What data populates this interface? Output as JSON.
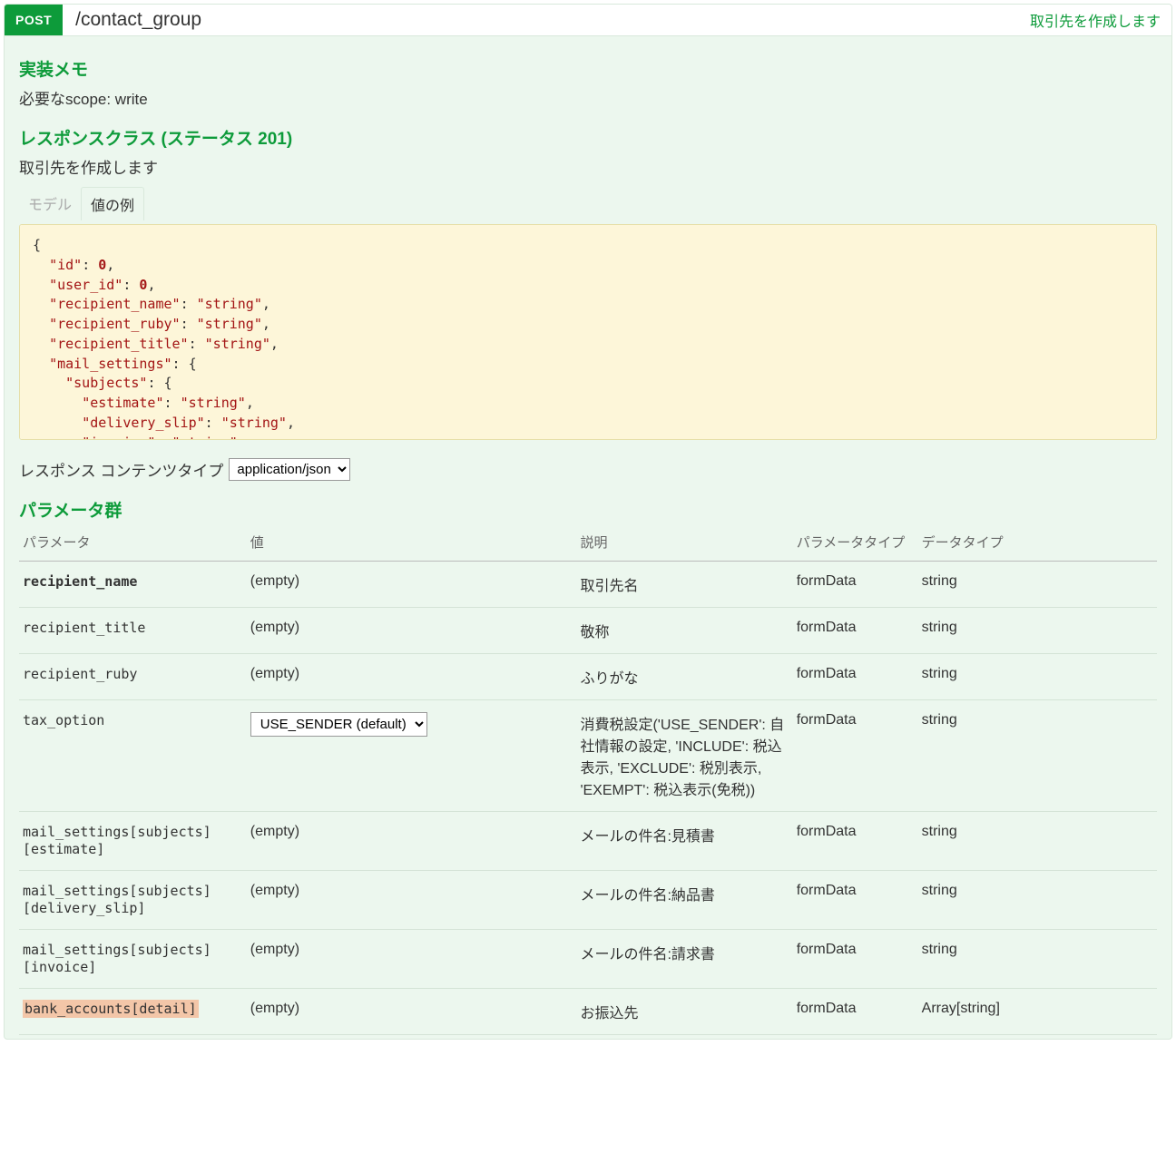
{
  "header": {
    "method": "POST",
    "path": "/contact_group",
    "summary": "取引先を作成します"
  },
  "memo": {
    "title": "実装メモ",
    "body": "必要なscope: write"
  },
  "response": {
    "title": "レスポンスクラス (ステータス 201)",
    "description": "取引先を作成します",
    "tab_model": "モデル",
    "tab_example": "値の例"
  },
  "content_type": {
    "label": "レスポンス コンテンツタイプ",
    "selected": "application/json"
  },
  "params_section": {
    "title": "パラメータ群",
    "headers": {
      "param": "パラメータ",
      "value": "値",
      "desc": "説明",
      "ptype": "パラメータタイプ",
      "dtype": "データタイプ"
    }
  },
  "tax_option_selected": "USE_SENDER (default)",
  "empty_text": "(empty)",
  "params": [
    {
      "name": "recipient_name",
      "required": true,
      "value_type": "empty",
      "desc": "取引先名",
      "ptype": "formData",
      "dtype": "string"
    },
    {
      "name": "recipient_title",
      "value_type": "empty",
      "desc": "敬称",
      "ptype": "formData",
      "dtype": "string"
    },
    {
      "name": "recipient_ruby",
      "value_type": "empty",
      "desc": "ふりがな",
      "ptype": "formData",
      "dtype": "string"
    },
    {
      "name": "tax_option",
      "value_type": "select",
      "desc": "消費税設定('USE_SENDER': 自社情報の設定, 'INCLUDE': 税込表示, 'EXCLUDE': 税別表示, 'EXEMPT': 税込表示(免税))",
      "ptype": "formData",
      "dtype": "string"
    },
    {
      "name": "mail_settings[subjects][estimate]",
      "value_type": "empty",
      "desc": "メールの件名:見積書",
      "ptype": "formData",
      "dtype": "string"
    },
    {
      "name": "mail_settings[subjects][delivery_slip]",
      "value_type": "empty",
      "desc": "メールの件名:納品書",
      "ptype": "formData",
      "dtype": "string"
    },
    {
      "name": "mail_settings[subjects][invoice]",
      "value_type": "empty",
      "desc": "メールの件名:請求書",
      "ptype": "formData",
      "dtype": "string"
    },
    {
      "name": "bank_accounts[detail]",
      "deprecated": true,
      "value_type": "empty",
      "desc": "お振込先",
      "ptype": "formData",
      "dtype": "Array[string]"
    }
  ]
}
